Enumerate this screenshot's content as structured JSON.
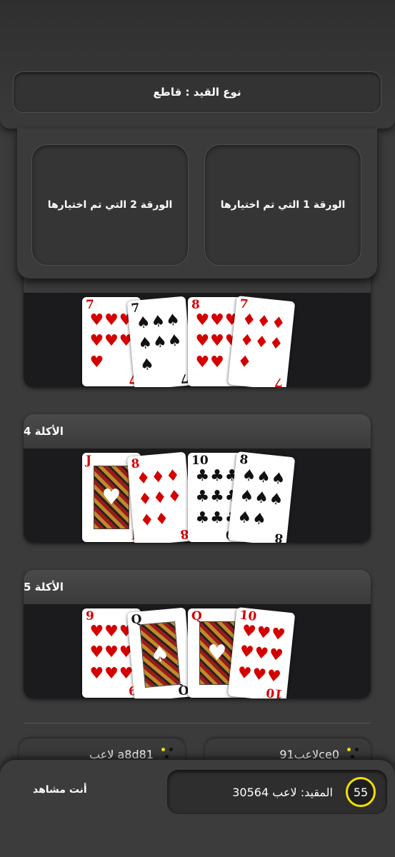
{
  "header": {
    "trump_label": "نوع القيد : قاطع"
  },
  "selection": {
    "card1_label": "الورقة 1 التي تم اختيارها",
    "card2_label": "الورقة 2 التي تم اختيارها"
  },
  "tricks": [
    {
      "title": "",
      "cards": [
        {
          "rank": "7",
          "suit": "♥",
          "color": "red"
        },
        {
          "rank": "7",
          "suit": "♠",
          "color": "black"
        },
        {
          "rank": "8",
          "suit": "♥",
          "color": "red"
        },
        {
          "rank": "7",
          "suit": "♦",
          "color": "red"
        }
      ]
    },
    {
      "title": "الأكلة 4",
      "cards": [
        {
          "rank": "J",
          "suit": "♥",
          "color": "red",
          "face": true
        },
        {
          "rank": "8",
          "suit": "♦",
          "color": "red"
        },
        {
          "rank": "10",
          "suit": "♣",
          "color": "black"
        },
        {
          "rank": "8",
          "suit": "♠",
          "color": "black"
        }
      ]
    },
    {
      "title": "الأكلة 5",
      "cards": [
        {
          "rank": "9",
          "suit": "♥",
          "color": "red"
        },
        {
          "rank": "Q",
          "suit": "♠",
          "color": "black",
          "face": true
        },
        {
          "rank": "Q",
          "suit": "♥",
          "color": "red",
          "face": true
        },
        {
          "rank": "10",
          "suit": "♥",
          "color": "red"
        }
      ]
    }
  ],
  "players": {
    "left": "لاعب a8d81",
    "right": "لاعب91ce0"
  },
  "bottom": {
    "bidder_label": "المقيد:",
    "bidder_name": "لاعب 30564",
    "timer": "55",
    "spectator": "أنت مشاهد"
  },
  "colors": {
    "timer_ring": "#f0e000",
    "red_suit": "#d40000"
  }
}
